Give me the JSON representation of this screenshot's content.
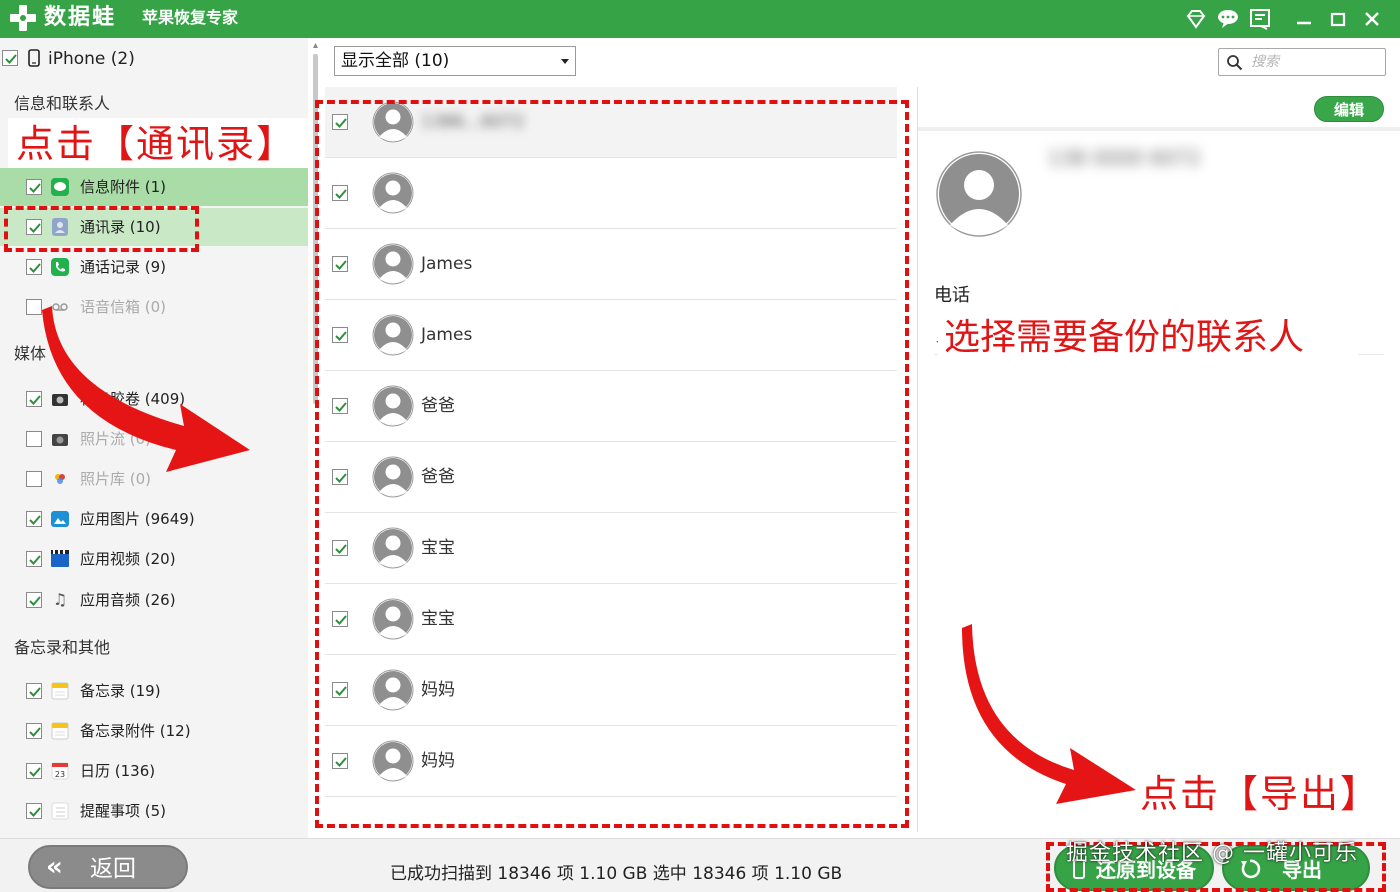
{
  "app": {
    "title": "数据蛙",
    "subtitle": "苹果恢复专家",
    "accent_color": "#37a347",
    "titlebar_icons": [
      "diamond-icon",
      "chat-icon",
      "feedback-icon",
      "minimize-icon",
      "maximize-icon",
      "close-icon"
    ]
  },
  "sidebar": {
    "device_label": "iPhone (2)",
    "sections": [
      {
        "title": "信息和联系人",
        "items": [
          {
            "label": "信息附件 (1)",
            "checked": true,
            "icon": "message-icon"
          },
          {
            "label": "通讯录 (10)",
            "checked": true,
            "icon": "contacts-icon",
            "selected": true
          },
          {
            "label": "通话记录 (9)",
            "checked": true,
            "icon": "phone-icon"
          },
          {
            "label": "语音信箱 (0)",
            "checked": false,
            "icon": "voicemail-icon"
          }
        ]
      },
      {
        "title": "媒体",
        "items": [
          {
            "label": "相机胶卷 (409)",
            "checked": true,
            "icon": "camera-icon"
          },
          {
            "label": "照片流 (0)",
            "checked": false,
            "icon": "photostream-icon"
          },
          {
            "label": "照片库 (0)",
            "checked": false,
            "icon": "photos-icon"
          },
          {
            "label": "应用图片 (9649)",
            "checked": true,
            "icon": "app-photos-icon"
          },
          {
            "label": "应用视频 (20)",
            "checked": true,
            "icon": "app-video-icon"
          },
          {
            "label": "应用音频 (26)",
            "checked": true,
            "icon": "music-note-icon"
          }
        ]
      },
      {
        "title": "备忘录和其他",
        "items": [
          {
            "label": "备忘录 (19)",
            "checked": true,
            "icon": "notes-icon"
          },
          {
            "label": "备忘录附件 (12)",
            "checked": true,
            "icon": "notes-attachment-icon"
          },
          {
            "label": "日历 (136)",
            "checked": true,
            "icon": "calendar-icon"
          },
          {
            "label": "提醒事项 (5)",
            "checked": true,
            "icon": "reminders-icon"
          }
        ]
      }
    ]
  },
  "toolbar": {
    "filter_selected": "显示全部 (10)",
    "search_placeholder": "搜索"
  },
  "contacts": [
    {
      "name": "1386…6072",
      "checked": true,
      "blurred": true
    },
    {
      "name": "",
      "checked": true,
      "blurred": true
    },
    {
      "name": "James",
      "checked": true
    },
    {
      "name": "James",
      "checked": true
    },
    {
      "name": "爸爸",
      "checked": true
    },
    {
      "name": "爸爸",
      "checked": true
    },
    {
      "name": "宝宝",
      "checked": true
    },
    {
      "name": "宝宝",
      "checked": true
    },
    {
      "name": "妈妈",
      "checked": true
    },
    {
      "name": "妈妈",
      "checked": true
    }
  ],
  "detail": {
    "edit_label": "编辑",
    "name": "138 0000 6072",
    "phone_label": "电话",
    "phone_value": "手"
  },
  "bottom": {
    "back_label": "返回",
    "back_icon_glyph": "«",
    "status_text": "已成功扫描到 18346 项 1.10 GB  选中 18346 项 1.10 GB",
    "restore_label": "还原到设备",
    "export_label": "导出"
  },
  "annotations": {
    "click_contacts": "点击【通讯录】",
    "select_contacts": "选择需要备份的联系人",
    "click_export": "点击【导出】",
    "annotation_color": "#e01515"
  },
  "watermark": "掘金技术社区 @ 一罐小可乐"
}
